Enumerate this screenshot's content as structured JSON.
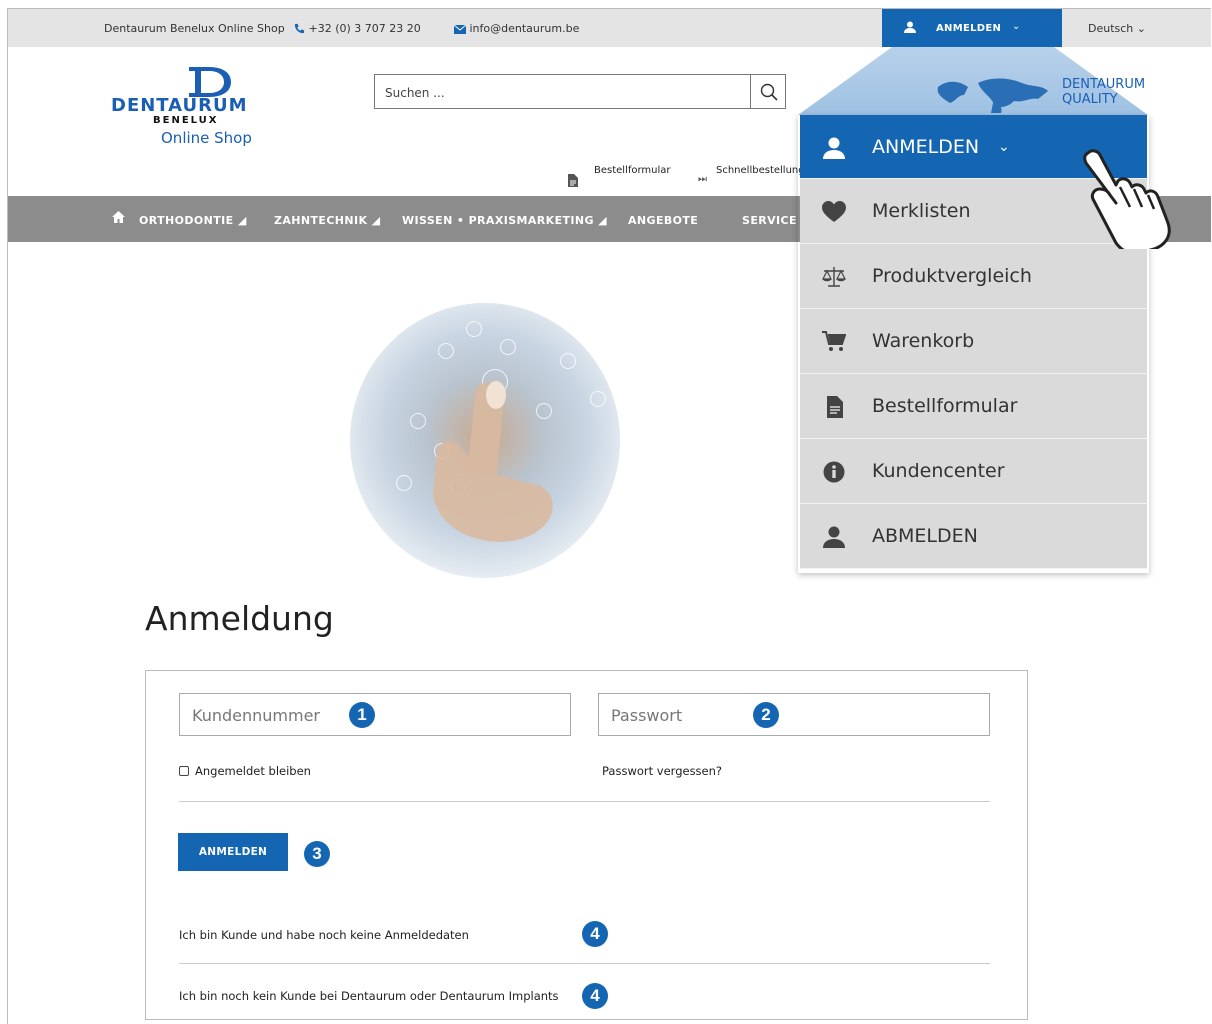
{
  "topbar": {
    "shop_name": "Dentaurum Benelux Online Shop",
    "phone": "+32 (0) 3 707 23 20",
    "email": "info@dentaurum.be",
    "login_label": "ANMELDEN",
    "language": "Deutsch"
  },
  "header": {
    "logo_word": "DENTAURUM",
    "logo_sub": "BENELUX",
    "logo_shop": "Online Shop",
    "search_placeholder": "Suchen ...",
    "quick_links": [
      "Bestellformular",
      "Schnellbestellung"
    ],
    "quality_line1": "DENTAURUM",
    "quality_line2": "QUALITY"
  },
  "nav": {
    "items": [
      "ORTHODONTIE",
      "ZAHNTECHNIK",
      "WISSEN • PRAXISMARKETING",
      "ANGEBOTE",
      "SERVICE"
    ]
  },
  "dropdown": {
    "items": [
      {
        "label": "ANMELDEN",
        "icon": "user-icon"
      },
      {
        "label": "Merklisten",
        "icon": "heart-icon"
      },
      {
        "label": "Produktvergleich",
        "icon": "scale-icon"
      },
      {
        "label": "Warenkorb",
        "icon": "cart-icon"
      },
      {
        "label": "Bestellformular",
        "icon": "document-icon"
      },
      {
        "label": "Kundencenter",
        "icon": "info-icon"
      },
      {
        "label": "ABMELDEN",
        "icon": "user-icon"
      }
    ]
  },
  "form": {
    "title": "Anmeldung",
    "customer_placeholder": "Kundennummer",
    "password_placeholder": "Passwort",
    "remember_label": "Angemeldet bleiben",
    "forgot_label": "Passwort vergessen?",
    "submit_label": "ANMELDEN",
    "no_credentials": "Ich bin Kunde und habe noch keine Anmeldedaten",
    "not_customer": "Ich bin noch kein Kunde bei Dentaurum oder Dentaurum Implants",
    "badges": [
      "1",
      "2",
      "3",
      "4",
      "4"
    ]
  },
  "colors": {
    "brand": "#1566b2",
    "nav": "#8c8c8c",
    "menu": "#dadada"
  }
}
